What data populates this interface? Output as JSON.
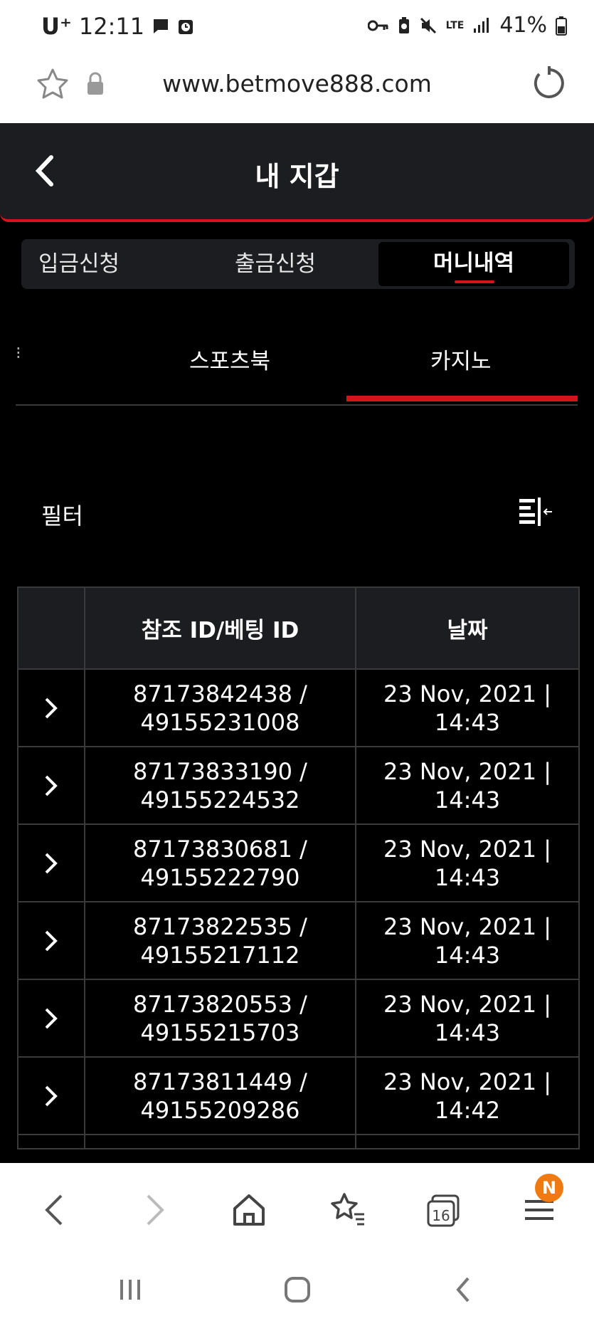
{
  "status_bar": {
    "carrier": "U⁺",
    "time": "12:11",
    "network": "LTE",
    "battery": "41%"
  },
  "browser": {
    "url": "www.betmove888.com"
  },
  "header": {
    "title": "내 지갑"
  },
  "tabs": [
    {
      "label": "입금신청"
    },
    {
      "label": "출금신청"
    },
    {
      "label": "머니내역",
      "active": true
    }
  ],
  "subtabs": [
    {
      "label": "⁝"
    },
    {
      "label": "스포츠북"
    },
    {
      "label": "카지노",
      "active": true
    }
  ],
  "filter": {
    "label": "필터"
  },
  "table": {
    "headers": [
      "",
      "참조 ID/베팅 ID",
      "날짜"
    ],
    "rows": [
      {
        "ref": "87173842438 /",
        "bet": "49155231008",
        "date": "23 Nov, 2021 |",
        "time": "14:43"
      },
      {
        "ref": "87173833190 /",
        "bet": "49155224532",
        "date": "23 Nov, 2021 |",
        "time": "14:43"
      },
      {
        "ref": "87173830681 /",
        "bet": "49155222790",
        "date": "23 Nov, 2021 |",
        "time": "14:43"
      },
      {
        "ref": "87173822535 /",
        "bet": "49155217112",
        "date": "23 Nov, 2021 |",
        "time": "14:43"
      },
      {
        "ref": "87173820553 /",
        "bet": "49155215703",
        "date": "23 Nov, 2021 |",
        "time": "14:43"
      },
      {
        "ref": "87173811449 /",
        "bet": "49155209286",
        "date": "23 Nov, 2021 |",
        "time": "14:42"
      }
    ]
  },
  "bottom_nav": {
    "tab_count": "16",
    "badge": "N"
  },
  "colors": {
    "accent": "#d4141b",
    "header_bg": "#1c1d21",
    "badge": "#f07a12"
  }
}
